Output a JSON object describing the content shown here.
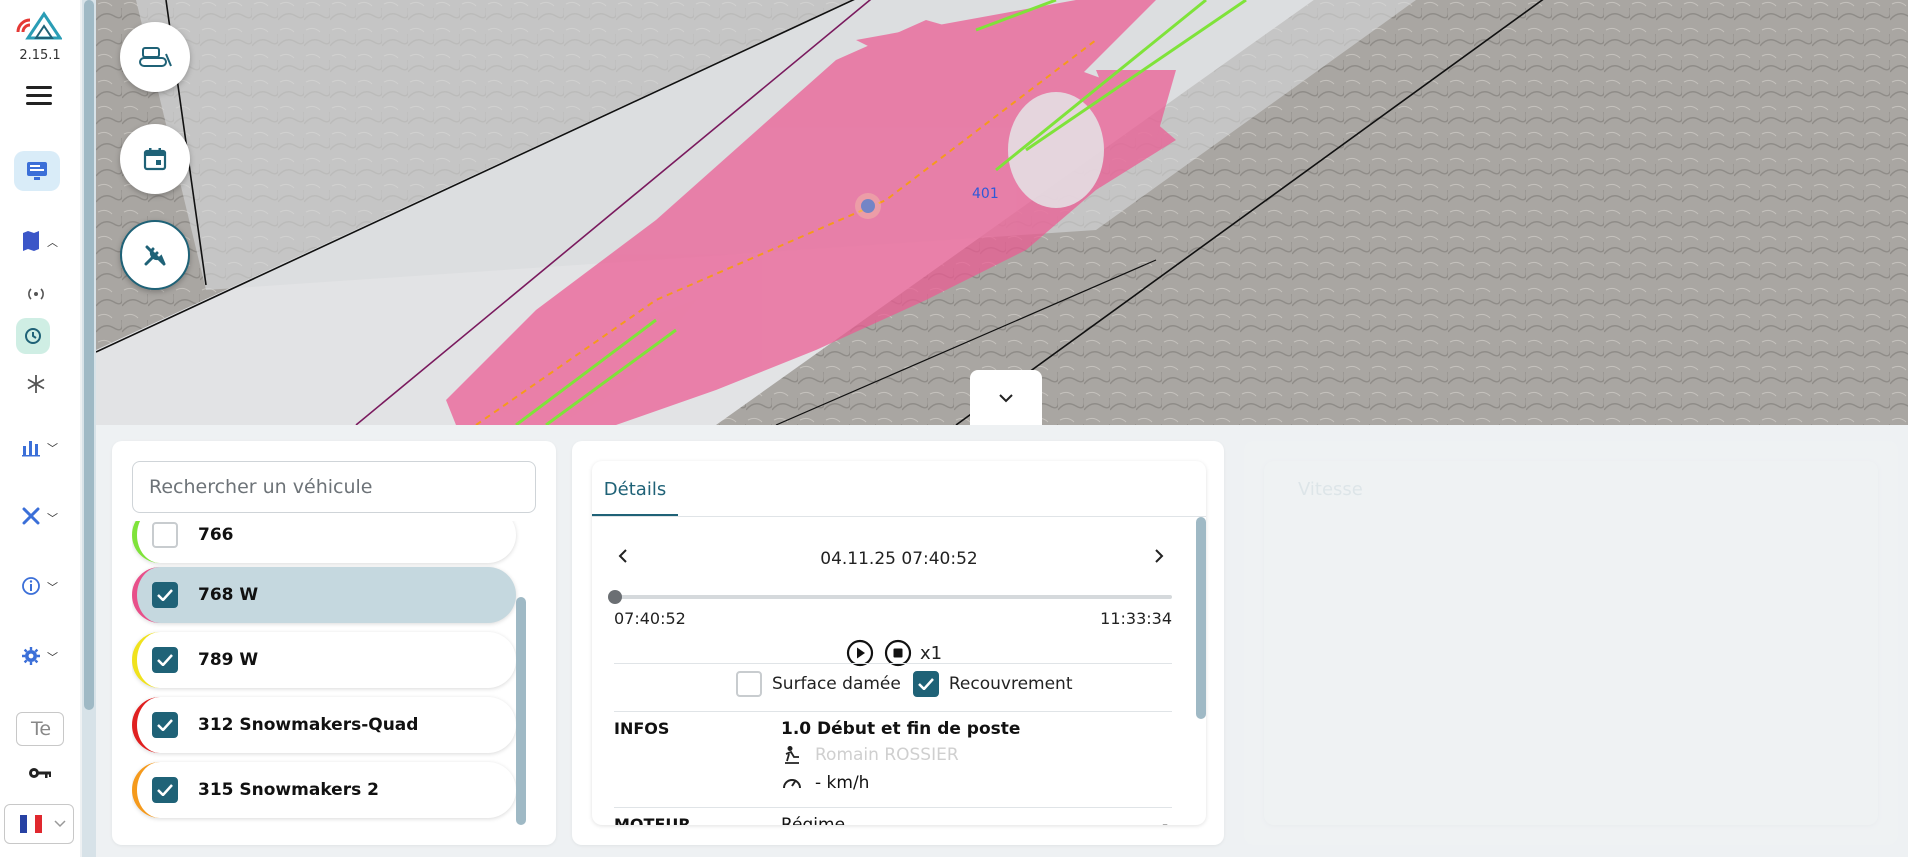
{
  "app": {
    "version": "2.15.1"
  },
  "sidebar": {
    "icons": [
      {
        "name": "monitor-icon"
      },
      {
        "name": "map-icon"
      },
      {
        "name": "broadcast-icon"
      },
      {
        "name": "history-icon"
      },
      {
        "name": "snowflake-icon"
      },
      {
        "name": "chart-icon"
      },
      {
        "name": "tools-icon"
      },
      {
        "name": "info-icon"
      },
      {
        "name": "settings-icon"
      }
    ],
    "text_select_value": "Te",
    "language": "FR",
    "colors": {
      "accent": "#1f6277",
      "active_bg": "#d9ecf8",
      "history_bg": "#cfeee4"
    }
  },
  "map": {
    "vehicle_label": "401",
    "overlay_color": "#e8508a",
    "track_color": "#7fe33a",
    "controls": [
      "zoom-in-icon",
      "zoom-out-icon",
      "ruler-icon",
      "layers-icon",
      "home-icon"
    ],
    "fabs": [
      "groomer-icon",
      "calendar-icon",
      "tools-icon"
    ]
  },
  "vehicles": {
    "search_placeholder": "Rechercher un véhicule",
    "items": [
      {
        "name": "766",
        "checked": false,
        "color": "#7fe33a"
      },
      {
        "name": "768 W",
        "checked": true,
        "color": "#e8508a"
      },
      {
        "name": "789 W",
        "checked": true,
        "color": "#f0e21d"
      },
      {
        "name": "312 Snowmakers-Quad",
        "checked": true,
        "color": "#e02020"
      },
      {
        "name": "315 Snowmakers 2",
        "checked": true,
        "color": "#f59a1c"
      }
    ]
  },
  "details": {
    "tab_label": "Détails",
    "datetime": "04.11.25 07:40:52",
    "start_time": "07:40:52",
    "end_time": "11:33:34",
    "speed_multiplier": "x1",
    "surface_label": "Surface damée",
    "overlap_label": "Recouvrement",
    "infos_label": "INFOS",
    "infos_value": "1.0 Début et fin de poste",
    "driver": "Romain ROSSIER",
    "speed_value": "- km/h",
    "engine_label": "MOTEUR",
    "engine_regime": "Régime",
    "engine_value": "-"
  },
  "speed_panel": {
    "tab_label": "Vitesse"
  }
}
